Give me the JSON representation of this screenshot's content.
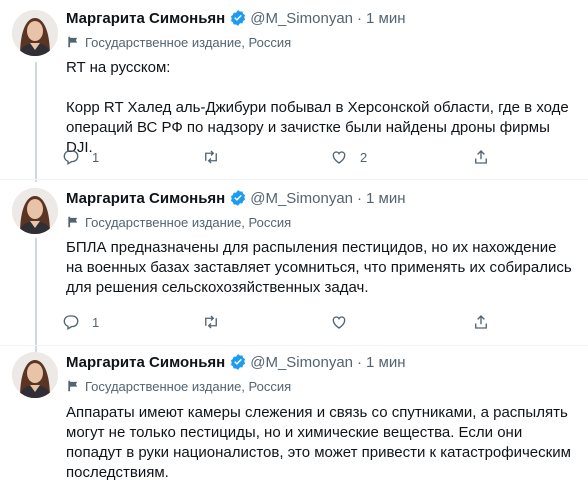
{
  "author": {
    "display_name": "Маргарита Симоньян",
    "handle": "@M_Simonyan",
    "separator": "·",
    "state_label": "Государственное издание, Россия"
  },
  "colors": {
    "text": "#0f1419",
    "secondary": "#536471",
    "verified": "#1d9bf0",
    "divider": "#eff3f4"
  },
  "tweets": [
    {
      "time": "1 мин",
      "paragraphs": [
        "RT на русском:",
        "Корр RT Халед аль-Джибури побывал в Херсонской области, где в ходе операций ВС РФ по надзору и зачистке были найдены дроны фирмы DJI."
      ],
      "reply_count": "1",
      "like_count": "2"
    },
    {
      "time": "1 мин",
      "paragraphs": [
        "БПЛА предназначены для распыления пестицидов, но их нахождение на военных базах заставляет усомниться, что применять их собирались для решения сельскохозяйственных задач."
      ],
      "reply_count": "1"
    },
    {
      "time": "1 мин",
      "paragraphs": [
        "Аппараты имеют камеры слежения и связь со спутниками, а распылять могут не только пестициды, но и химические вещества. Если они попадут в руки националистов, это может привести к катастрофическим последствиям."
      ]
    }
  ]
}
